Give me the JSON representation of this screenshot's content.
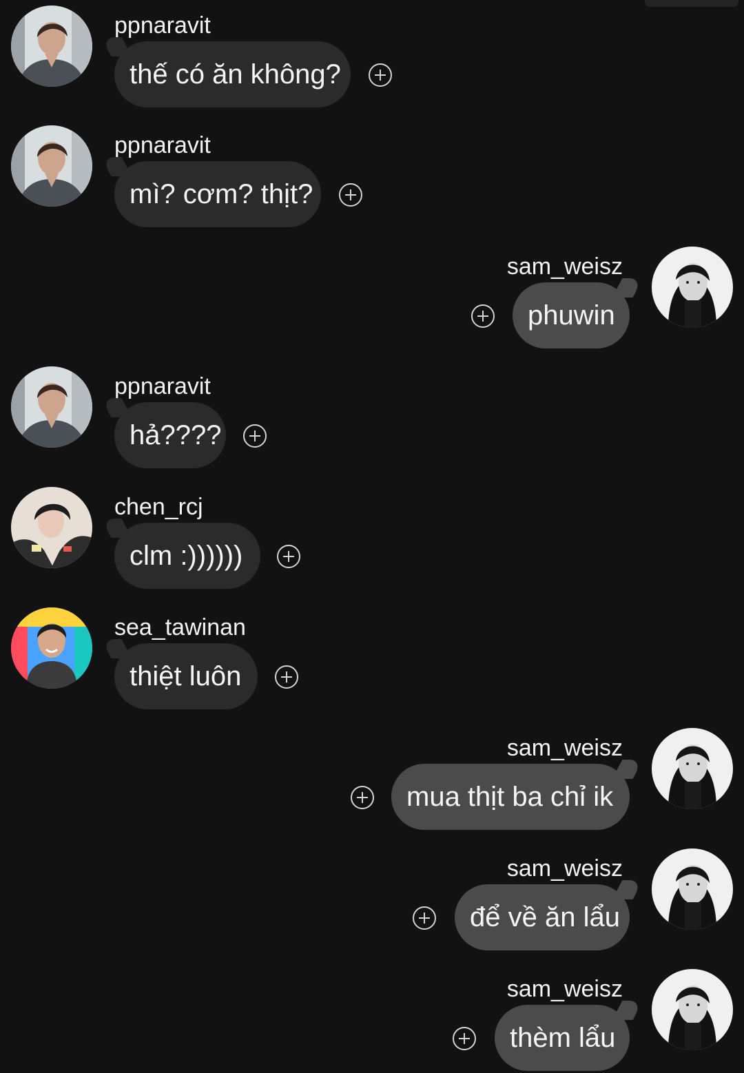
{
  "chat": {
    "messages": [
      {
        "side": "left",
        "username": "ppnaravit",
        "text": "thế có ăn không?",
        "avatar_icon": "ppnaravit-avatar-icon"
      },
      {
        "side": "left",
        "username": "ppnaravit",
        "text": "mì? cơm? thịt?",
        "avatar_icon": "ppnaravit-avatar-icon"
      },
      {
        "side": "right",
        "username": "sam_weisz",
        "text": "phuwin",
        "avatar_icon": "sam-weisz-avatar-icon"
      },
      {
        "side": "left",
        "username": "ppnaravit",
        "text": "hả????",
        "avatar_icon": "ppnaravit-avatar-icon"
      },
      {
        "side": "left",
        "username": "chen_rcj",
        "text": "clm :))))))",
        "avatar_icon": "chen-rcj-avatar-icon"
      },
      {
        "side": "left",
        "username": "sea_tawinan",
        "text": "thiệt luôn",
        "avatar_icon": "sea-tawinan-avatar-icon"
      },
      {
        "side": "right",
        "username": "sam_weisz",
        "text": "mua thịt ba chỉ ik",
        "avatar_icon": "sam-weisz-avatar-icon"
      },
      {
        "side": "right",
        "username": "sam_weisz",
        "text": "để về ăn lẩu",
        "avatar_icon": "sam-weisz-avatar-icon"
      },
      {
        "side": "right",
        "username": "sam_weisz",
        "text": "thèm lẩu",
        "avatar_icon": "sam-weisz-avatar-icon"
      }
    ]
  },
  "icons": {
    "reaction": "add-reaction-icon"
  },
  "colors": {
    "background": "#121212",
    "incoming_bubble": "#2b2b2b",
    "outgoing_bubble": "#4b4b4b",
    "text": "#f2f2f2"
  }
}
